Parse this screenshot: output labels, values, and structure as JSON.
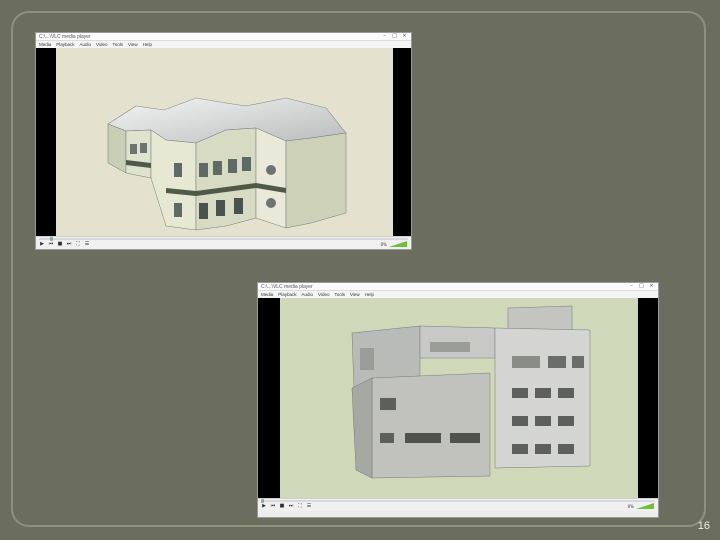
{
  "slide": {
    "page_number": "16"
  },
  "player1": {
    "title": "C:\\...\\VLC media player",
    "menu": [
      "Media",
      "Playback",
      "Audio",
      "Video",
      "Tools",
      "View",
      "Help"
    ],
    "volume": "0%",
    "progress": 0.03
  },
  "player2": {
    "title": "C:\\...\\VLC media player",
    "menu": [
      "Media",
      "Playback",
      "Audio",
      "Video",
      "Tools",
      "View",
      "Help"
    ],
    "volume": "0%",
    "progress": 0.0
  },
  "colors": {
    "background": "#6b6d5e",
    "scene1_bg": "#e4e1cf",
    "scene2_bg": "#cfd8b8",
    "vlc_green": "#6fbf3a"
  }
}
